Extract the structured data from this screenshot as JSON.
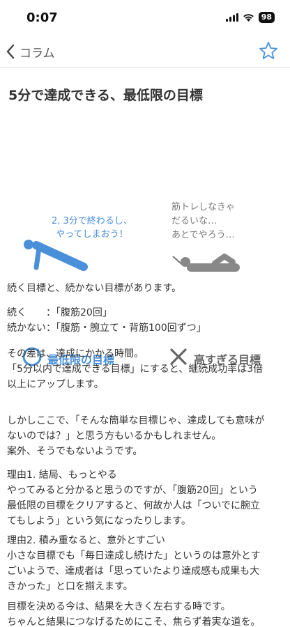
{
  "status": {
    "time": "0:07",
    "battery": "98"
  },
  "nav": {
    "back_label": "コラム"
  },
  "article": {
    "title": "5分で達成できる、最低限の目標",
    "illustration": {
      "good_caption": [
        "2, 3分で終わるし、",
        "やってしまおう！"
      ],
      "bad_caption": [
        "筋トレしなきゃ",
        "だるいな…",
        "あとでやろう…"
      ],
      "good_label": "最低限の目標",
      "bad_label": "高すぎる目標",
      "colors": {
        "good": "#4a90d9",
        "bad": "#777777"
      }
    },
    "paragraphs": [
      [
        "続く目標と、続かない目標があります。"
      ],
      [
        "続く　　：「腹筋20回」",
        "続かない：「腹筋・腕立て・背筋100回ずつ」"
      ],
      [
        "その差は、達成にかかる時間。",
        "「5分以内で達成できる目標」にすると、継続成功率は3倍",
        "以上にアップします。"
      ],
      [
        "しかしここで、「そんな簡単な目標じゃ、達成しても意味が",
        "ないのでは？」と思う方もいるかもしれません。",
        "案外、そうでもないようです。"
      ],
      [
        "理由1. 結局、もっとやる",
        "やってみると分かると思うのですが、「腹筋20回」という",
        "最低限の目標をクリアすると、何故か人は「ついでに腕立",
        "てもしよう」という気になったりします。"
      ],
      [
        "理由2. 積み重なると、意外とすごい",
        "小さな目標でも「毎日達成し続けた」というのは意外とす",
        "ごいようで、達成者は「思っていたより達成感も成果も大",
        "きかった」と口を揃えます。"
      ],
      [
        "目標を決める今は、結果を大きく左右する時です。",
        "ちゃんと結果につなげるためにこそ、焦らず着実な道を。"
      ]
    ]
  }
}
